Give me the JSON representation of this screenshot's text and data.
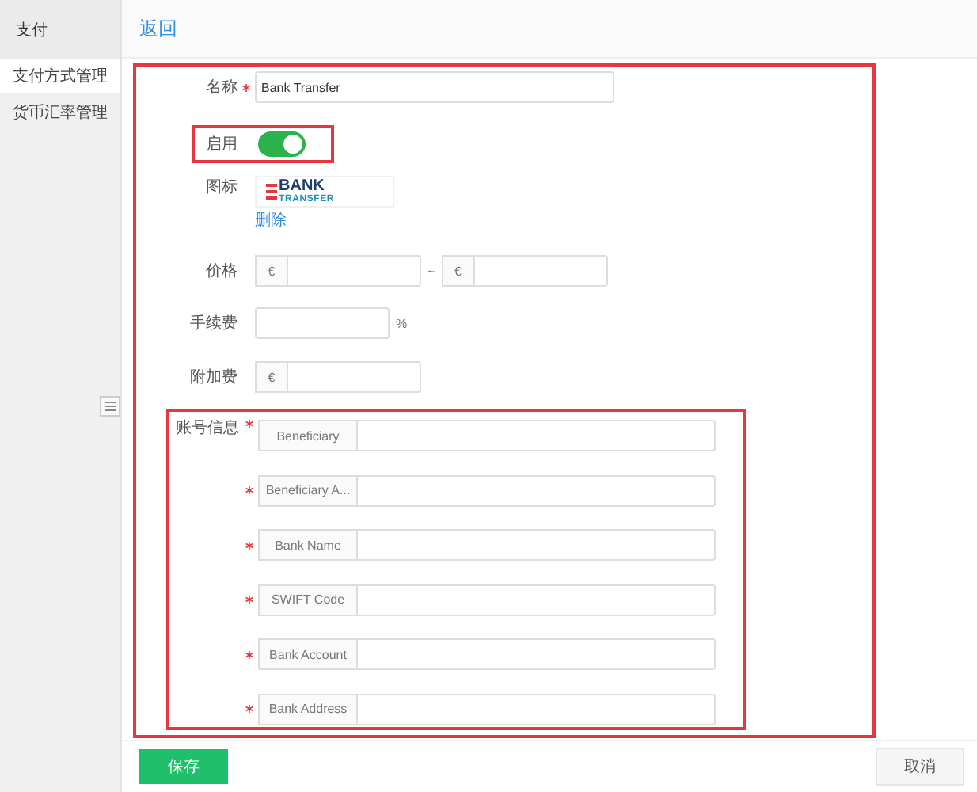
{
  "sidebar": {
    "title": "支付",
    "items": [
      {
        "label": "支付方式管理",
        "selected": true
      },
      {
        "label": "货币汇率管理",
        "selected": false
      }
    ]
  },
  "header": {
    "back_link": "返回"
  },
  "form": {
    "fields": [
      {
        "kind": "text",
        "label": "名称",
        "required": true,
        "value": "Bank Transfer"
      },
      {
        "kind": "toggle",
        "label": "启用",
        "on": true
      },
      {
        "kind": "logo",
        "label": "图标",
        "logo_top": "BANK",
        "logo_bottom": "TRANSFER",
        "delete_link": "删除"
      },
      {
        "kind": "range",
        "label": "价格",
        "prefix": "€",
        "separator": "~",
        "prefix_2": "€"
      },
      {
        "kind": "suffix",
        "label": "手续费",
        "suffix": "%"
      },
      {
        "kind": "prefix",
        "label": "附加费",
        "prefix": "€"
      }
    ],
    "account": {
      "label": "账号信息",
      "fields": [
        {
          "label": "Beneficiary",
          "required": true
        },
        {
          "label": "Beneficiary A...",
          "required": true
        },
        {
          "label": "Bank Name",
          "required": true
        },
        {
          "label": "SWIFT Code",
          "required": true
        },
        {
          "label": "Bank Account",
          "required": true
        },
        {
          "label": "Bank Address",
          "required": true
        }
      ]
    }
  },
  "footer": {
    "save": "保存",
    "cancel": "取消"
  }
}
